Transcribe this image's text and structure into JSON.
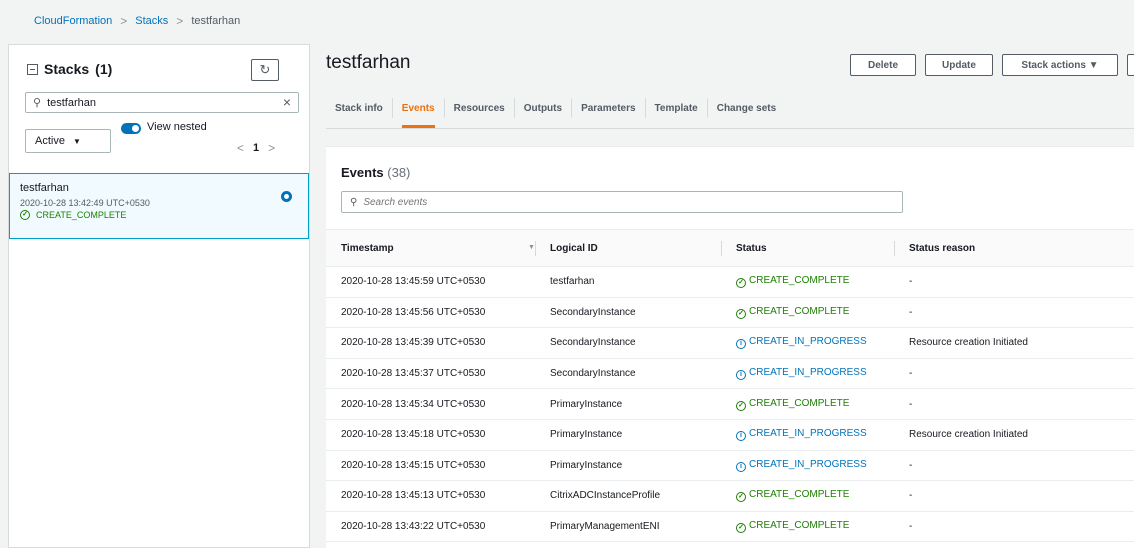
{
  "breadcrumb": {
    "root": "CloudFormation",
    "stacks": "Stacks",
    "current": "testfarhan"
  },
  "left_panel": {
    "heading": "Stacks",
    "count": "(1)",
    "search_value": "testfarhan",
    "filter_select": "Active",
    "toggle_label": "View nested",
    "page": "1",
    "stack": {
      "name": "testfarhan",
      "created": "2020-10-28 13:42:49 UTC+0530",
      "status": "CREATE_COMPLETE"
    }
  },
  "header": {
    "title": "testfarhan",
    "delete_label": "Delete",
    "update_label": "Update",
    "stack_actions_label": "Stack actions ▼"
  },
  "tabs": [
    "Stack info",
    "Events",
    "Resources",
    "Outputs",
    "Parameters",
    "Template",
    "Change sets"
  ],
  "events": {
    "title": "Events",
    "count": "(38)",
    "search_placeholder": "Search events",
    "columns": [
      "Timestamp",
      "Logical ID",
      "Status",
      "Status reason"
    ],
    "rows": [
      [
        "2020-10-28 13:45:59 UTC+0530",
        "testfarhan",
        "CREATE_COMPLETE",
        "-"
      ],
      [
        "2020-10-28 13:45:56 UTC+0530",
        "SecondaryInstance",
        "CREATE_COMPLETE",
        "-"
      ],
      [
        "2020-10-28 13:45:39 UTC+0530",
        "SecondaryInstance",
        "CREATE_IN_PROGRESS",
        "Resource creation Initiated"
      ],
      [
        "2020-10-28 13:45:37 UTC+0530",
        "SecondaryInstance",
        "CREATE_IN_PROGRESS",
        "-"
      ],
      [
        "2020-10-28 13:45:34 UTC+0530",
        "PrimaryInstance",
        "CREATE_COMPLETE",
        "-"
      ],
      [
        "2020-10-28 13:45:18 UTC+0530",
        "PrimaryInstance",
        "CREATE_IN_PROGRESS",
        "Resource creation Initiated"
      ],
      [
        "2020-10-28 13:45:15 UTC+0530",
        "PrimaryInstance",
        "CREATE_IN_PROGRESS",
        "-"
      ],
      [
        "2020-10-28 13:45:13 UTC+0530",
        "CitrixADCInstanceProfile",
        "CREATE_COMPLETE",
        "-"
      ],
      [
        "2020-10-28 13:43:22 UTC+0530",
        "PrimaryManagementENI",
        "CREATE_COMPLETE",
        "-"
      ]
    ]
  },
  "colors": {
    "link": "#0073bb",
    "success": "#1d8102",
    "in_progress": "#0073bb",
    "active_tab": "#ec7211"
  },
  "icons": {
    "success": "check-circle-icon",
    "in_progress": "info-circle-icon",
    "search": "search-icon",
    "refresh": "refresh-icon"
  }
}
